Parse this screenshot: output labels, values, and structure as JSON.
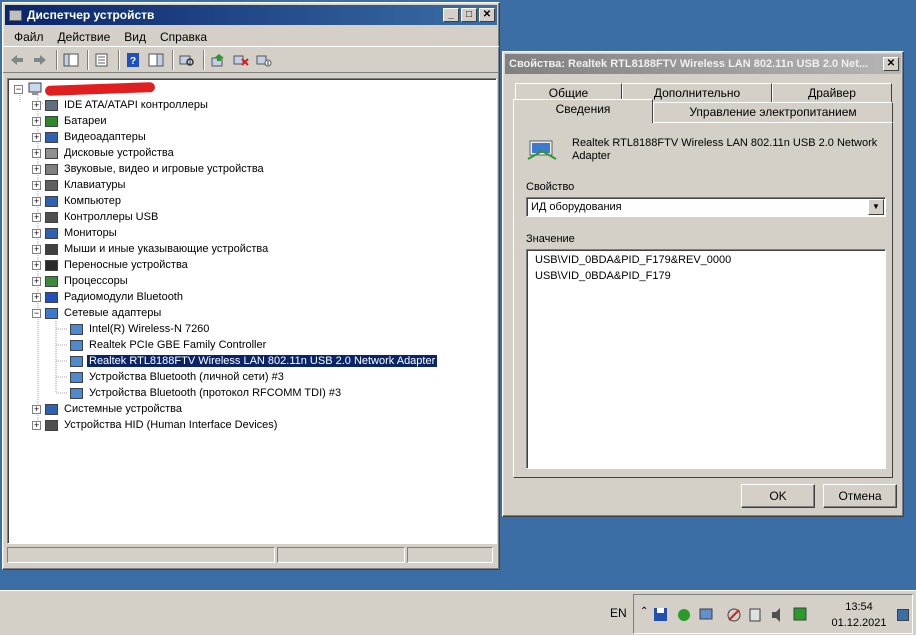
{
  "device_manager": {
    "title": "Диспетчер устройств",
    "menu": [
      "Файл",
      "Действие",
      "Вид",
      "Справка"
    ],
    "tree": {
      "categories": [
        "IDE ATA/ATAPI контроллеры",
        "Батареи",
        "Видеоадаптеры",
        "Дисковые устройства",
        "Звуковые, видео и игровые устройства",
        "Клавиатуры",
        "Компьютер",
        "Контроллеры USB",
        "Мониторы",
        "Мыши и иные указывающие устройства",
        "Переносные устройства",
        "Процессоры",
        "Радиомодули Bluetooth",
        "Сетевые адаптеры"
      ],
      "network_children": [
        "Intel(R) Wireless-N 7260",
        "Realtek PCIe GBE Family Controller",
        "Realtek RTL8188FTV Wireless LAN 802.11n USB 2.0 Network Adapter",
        "Устройства Bluetooth (личной сети) #3",
        "Устройства Bluetooth (протокол RFCOMM TDI) #3"
      ],
      "trailing_categories": [
        "Системные устройства",
        "Устройства HID (Human Interface Devices)"
      ]
    }
  },
  "properties": {
    "title": "Свойства: Realtek RTL8188FTV Wireless LAN 802.11n USB 2.0 Net...",
    "tabs_row1": [
      "Общие",
      "Дополнительно",
      "Драйвер"
    ],
    "tabs_row2": [
      "Сведения",
      "Управление электропитанием"
    ],
    "device_name": "Realtek RTL8188FTV Wireless LAN 802.11n USB 2.0 Network Adapter",
    "property_label": "Свойство",
    "property_selected": "ИД оборудования",
    "value_label": "Значение",
    "values": [
      "USB\\VID_0BDA&PID_F179&REV_0000",
      "USB\\VID_0BDA&PID_F179"
    ],
    "ok": "OK",
    "cancel": "Отмена"
  },
  "taskbar": {
    "language": "EN",
    "time": "13:54",
    "date": "01.12.2021"
  }
}
